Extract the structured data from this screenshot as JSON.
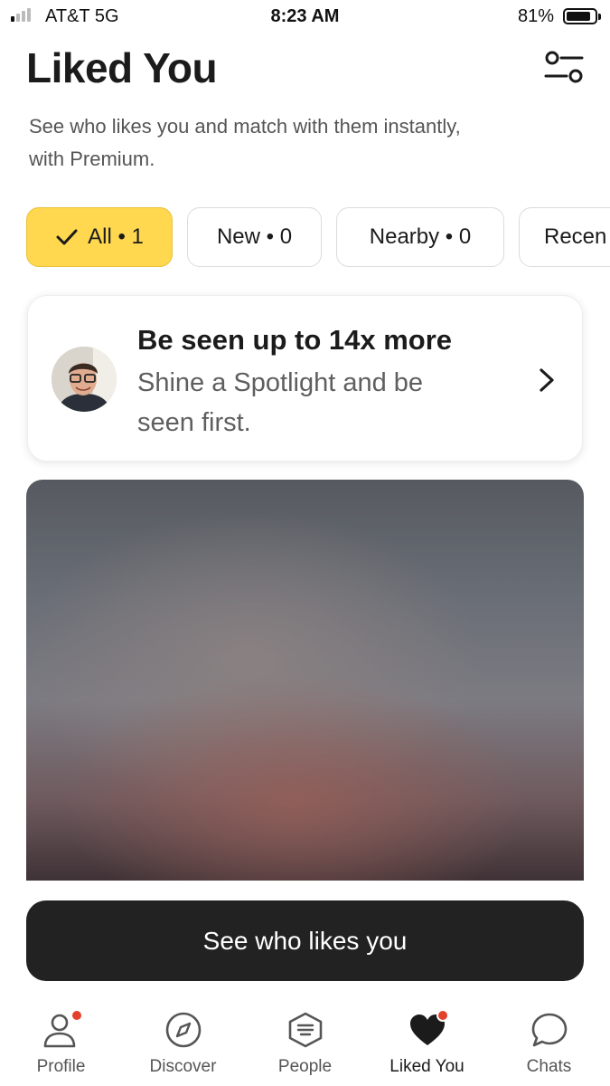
{
  "status_bar": {
    "carrier": "AT&T  5G",
    "time": "8:23 AM",
    "battery": "81%",
    "battery_level": 0.81,
    "signal_bars_filled": 1
  },
  "header": {
    "title": "Liked You",
    "subtitle": "See who likes you and match with them instantly, with Premium.",
    "filter_icon": "filter-sliders-icon"
  },
  "filters": [
    {
      "label": "All • 1",
      "selected": true
    },
    {
      "label": "New • 0",
      "selected": false
    },
    {
      "label": "Nearby • 0",
      "selected": false
    },
    {
      "label": "Recen",
      "selected": false
    }
  ],
  "spotlight": {
    "title": "Be seen up to 14x more",
    "description": "Shine a Spotlight and be seen first."
  },
  "cta": {
    "label": "See who likes you"
  },
  "tabs": [
    {
      "label": "Profile",
      "icon": "person-icon",
      "badge": true
    },
    {
      "label": "Discover",
      "icon": "compass-icon",
      "badge": false
    },
    {
      "label": "People",
      "icon": "hexagon-list-icon",
      "badge": false
    },
    {
      "label": "Liked You",
      "icon": "heart-icon",
      "badge": true,
      "active": true
    },
    {
      "label": "Chats",
      "icon": "chat-bubble-icon",
      "badge": false
    }
  ],
  "colors": {
    "accent": "#ffd84f",
    "cta_background": "#222222",
    "badge": "#e4412b"
  }
}
